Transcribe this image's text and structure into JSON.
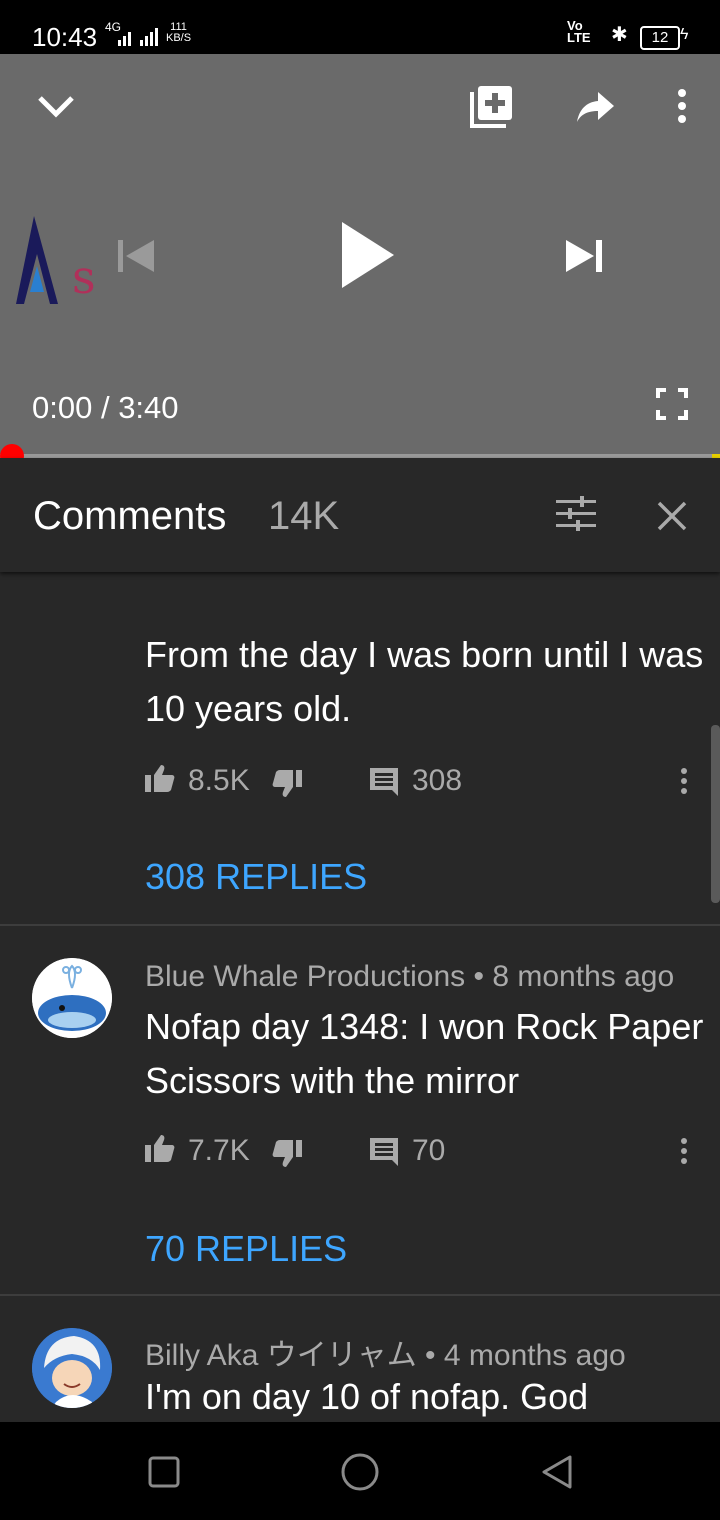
{
  "status_bar": {
    "time": "10:43",
    "network": "4G",
    "speed_value": "111",
    "speed_unit": "KB/S",
    "volte": "Vo LTE",
    "battery": "12"
  },
  "player": {
    "current_time": "0:00",
    "separator": " / ",
    "duration": "3:40",
    "progress_fraction": 0.0,
    "logo_letter": "s"
  },
  "comments_panel": {
    "title": "Comments",
    "count": "14K"
  },
  "comments": [
    {
      "text": "From the day I was born until I was 10 years old.",
      "likes": "8.5K",
      "reply_count": "308",
      "replies_label": "308 REPLIES"
    },
    {
      "author": "Blue Whale Productions",
      "age": "8 months ago",
      "text": "Nofap day 1348: I won Rock Paper Scissors with the mirror",
      "likes": "7.7K",
      "reply_count": "70",
      "replies_label": "70 REPLIES"
    },
    {
      "author": "Billy Aka ウイリャム",
      "age": "4 months ago",
      "text": "I'm on day 10 of nofap. God"
    }
  ],
  "colors": {
    "accent_link": "#3ea6ff",
    "progress_red": "#ff0000",
    "panel_bg": "#282828",
    "player_bg": "#6a6a6a"
  }
}
